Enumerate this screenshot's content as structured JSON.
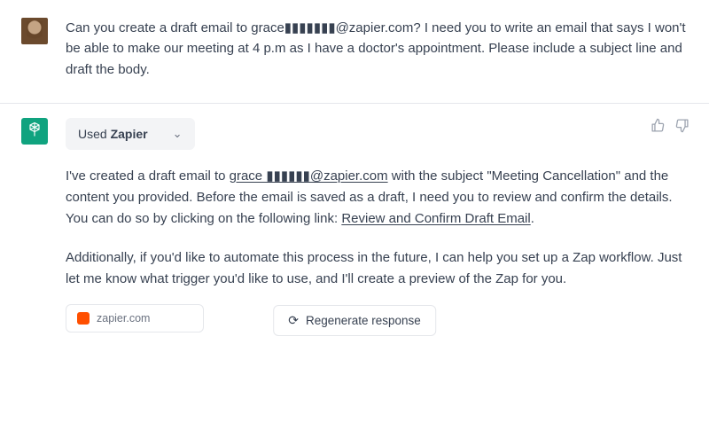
{
  "user": {
    "message": "Can you create a draft email to grace▮▮▮▮▮▮▮@zapier.com? I need you to write an email that says I won't be able to make our meeting at 4 p.m as I have a doctor's appointment. Please include a subject line and draft the body."
  },
  "assistant": {
    "plugin_used_prefix": "Used ",
    "plugin_name": "Zapier",
    "para1_a": "I've created a draft email to ",
    "email_text": "grace ▮▮▮▮▮▮@zapier.com",
    "para1_b": " with the subject \"Meeting Cancellation\" and the content you provided. Before the email is saved as a draft, I need you to review and confirm the details. You can do so by clicking on the following link: ",
    "review_link": "Review and Confirm Draft Email",
    "para1_c": ".",
    "para2": "Additionally, if you'd like to automate this process in the future, I can help you set up a Zap workflow. Just let me know what trigger you'd like to use, and I'll create a preview of the Zap for you.",
    "source_label": "zapier.com"
  },
  "controls": {
    "regenerate": "Regenerate response"
  },
  "icons": {
    "chevron_down": "⌄",
    "thumbs_up": "👍",
    "thumbs_down": "👎",
    "refresh": "⟳"
  }
}
